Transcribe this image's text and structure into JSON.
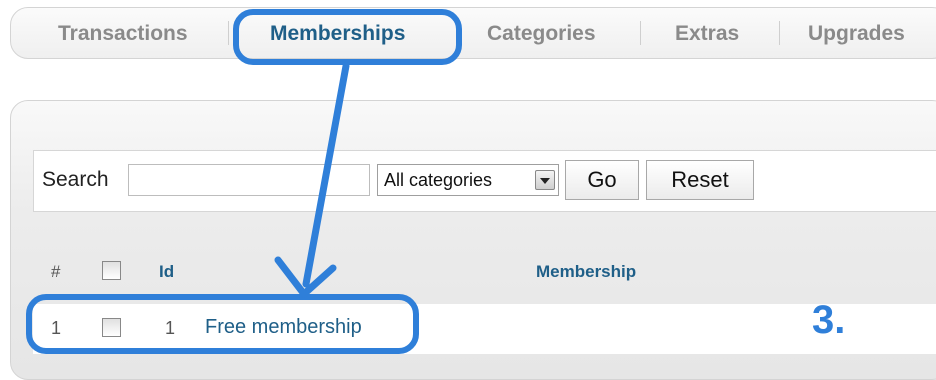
{
  "tabs": [
    {
      "label": "Transactions",
      "active": false
    },
    {
      "label": "Memberships",
      "active": true
    },
    {
      "label": "Categories",
      "active": false
    },
    {
      "label": "Extras",
      "active": false
    },
    {
      "label": "Upgrades",
      "active": false
    }
  ],
  "filter": {
    "search_label": "Search",
    "search_value": "",
    "category_selected": "All categories",
    "go_label": "Go",
    "reset_label": "Reset"
  },
  "table": {
    "columns": [
      "#",
      "",
      "Id",
      "Membership"
    ],
    "rows": [
      {
        "num": "1",
        "checked": false,
        "id": "1",
        "membership": "Free membership"
      }
    ]
  },
  "annotation": {
    "step_label": "3.",
    "color": "#2f7fd9"
  },
  "colors": {
    "accent": "#1f5f88",
    "inactive_tab": "#8a8a8a"
  }
}
